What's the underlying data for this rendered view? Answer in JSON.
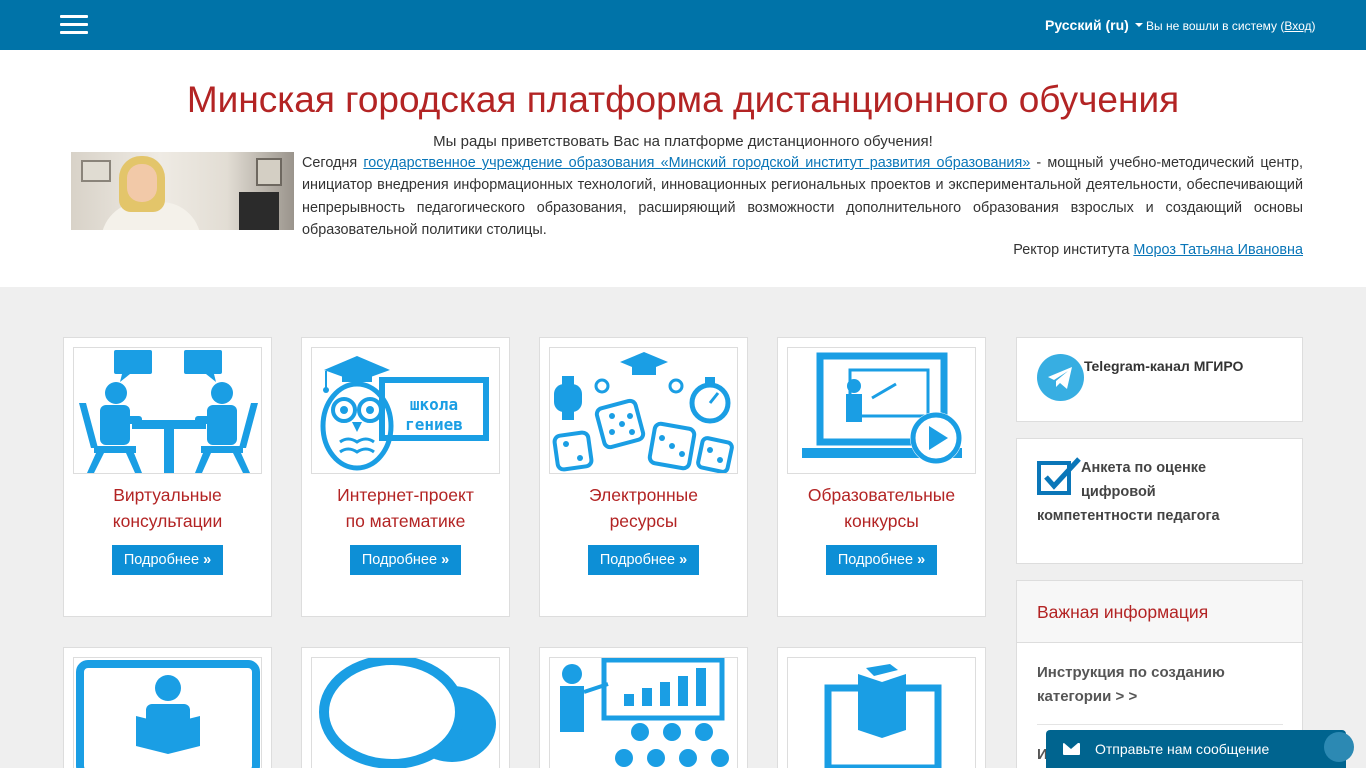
{
  "topbar": {
    "language": "Русский (ru)",
    "not_logged_in": "Вы не вошли в систему (",
    "login_link": "Вход",
    "close_paren": ")"
  },
  "intro": {
    "title": "Минская городская платформа дистанционного обучения",
    "welcome": "Мы рады приветствовать Вас на платформе дистанционного обучения!",
    "text_prefix": "Сегодня ",
    "institution_link": "государственное учреждение образования «Минский городской институт развития образования»",
    "text_suffix": " - мощный учебно-методический центр, инициатор внедрения информационных технологий, инновационных региональных проектов и экспериментальной деятельности, обеспечивающий непрерывность педагогического образования, расширяющий возможности дополнительного образования взрослых и создающий основы образовательной политики столицы.",
    "rector_prefix": "Ректор института ",
    "rector_link": "Мороз Татьяна Ивановна"
  },
  "cards": [
    {
      "line1": "Виртуальные",
      "line2": "консультации",
      "button": "Подробнее",
      "icon": "consultation-icon"
    },
    {
      "line1": "Интернет-проект",
      "line2": "по математике",
      "button": "Подробнее",
      "icon": "owl-school-icon",
      "image_text_1": "школа",
      "image_text_2": "гениев"
    },
    {
      "line1": "Электронные",
      "line2": "ресурсы",
      "button": "Подробнее",
      "icon": "dice-resources-icon"
    },
    {
      "line1": "Образовательные",
      "line2": "конкурсы",
      "button": "Подробнее",
      "icon": "screen-presentation-icon"
    }
  ],
  "cards_row2_icons": [
    "reading-screen-icon",
    "speech-bubbles-icon",
    "classroom-chart-icon",
    "laptop-book-icon"
  ],
  "raquo": "»",
  "sidebar": {
    "telegram": {
      "title": "Telegram-канал МГИРО",
      "icon": "telegram-icon"
    },
    "survey": {
      "line1": "Анкета по оценке",
      "line2": "цифровой",
      "line3": "компетентности педагога",
      "icon": "checkbox-check-icon"
    },
    "info": {
      "title": "Важная информация",
      "item1_line1": "Инструкция по созданию",
      "item1_line2": "категории > >",
      "item2_partial": "И"
    }
  },
  "message_widget": {
    "label": "Отправьте нам сообщение",
    "icon": "envelope-icon"
  },
  "colors": {
    "topbar": "#0073a8",
    "accent_red": "#b32424",
    "button_blue": "#0d8fd6",
    "icon_blue": "#1a9ee4",
    "link_blue": "#0a76b8"
  }
}
